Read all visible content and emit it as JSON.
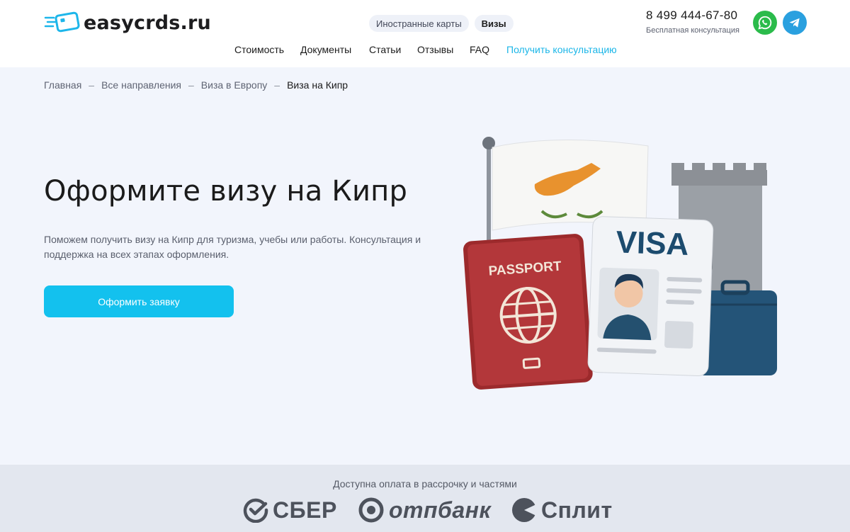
{
  "header": {
    "logo_text": "easycrds.ru",
    "top_tabs": [
      "Иностранные карты",
      "Визы"
    ],
    "phone": "8 499 444-67-80",
    "phone_caption": "Бесплатная консультация",
    "nav": [
      "Стоимость",
      "Документы",
      "Статьи",
      "Отзывы",
      "FAQ",
      "Получить консультацию"
    ]
  },
  "breadcrumb": [
    "Главная",
    "Все направления",
    "Виза в Европу",
    "Виза на Кипр"
  ],
  "hero": {
    "title": "Оформите визу на Кипр",
    "description": "Поможем получить визу на Кипр для туризма, учебы или работы. Консультация и поддержка на всех этапах оформления.",
    "cta_label": "Оформить заявку",
    "passport_label": "PASSPORT",
    "visa_label": "VISA"
  },
  "payment": {
    "caption": "Доступна оплата в рассрочку и частями",
    "logos": [
      "СБЕР",
      "отпбанк",
      "Сплит"
    ]
  },
  "colors": {
    "accent": "#13c1ee",
    "hero_bg": "#f2f5fc",
    "payment_bg": "#e3e7ef",
    "whatsapp": "#2bbb4b",
    "telegram": "#2aa0df"
  },
  "icons": [
    "logo-card-icon",
    "whatsapp-icon",
    "telegram-icon",
    "sber-logo-icon",
    "otp-logo-icon",
    "split-logo-icon"
  ]
}
